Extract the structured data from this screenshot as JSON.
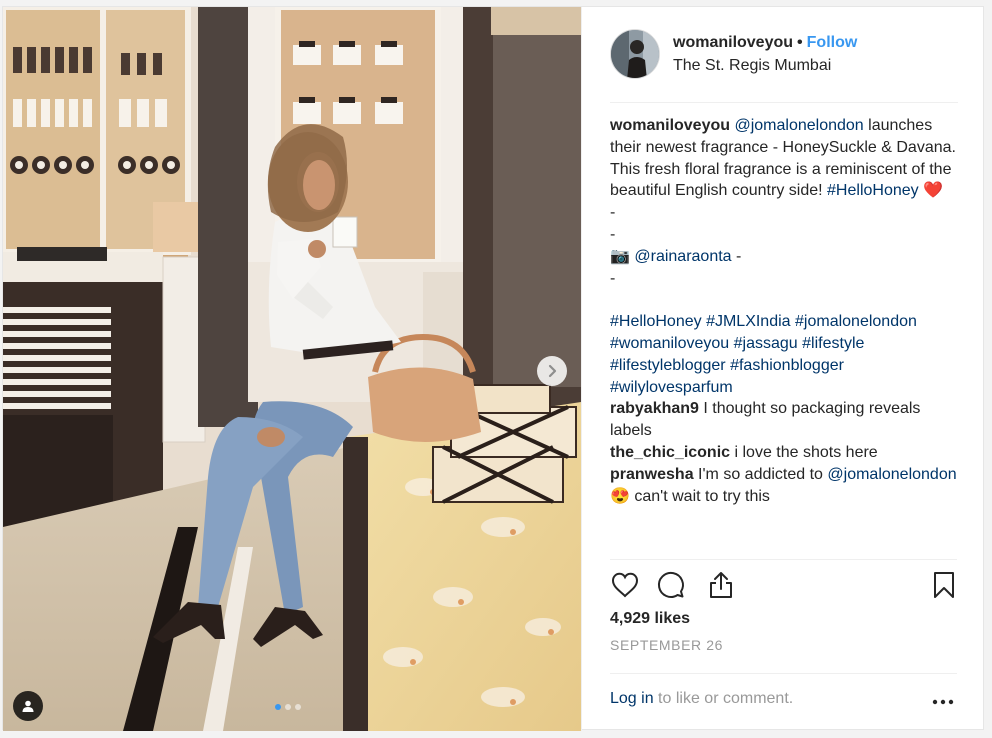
{
  "post": {
    "username": "womaniloveyou",
    "separator": "•",
    "follow_label": "Follow",
    "location": "The St. Regis Mumbai",
    "caption": {
      "username": "womaniloveyou",
      "mention": "@jomalonelondon",
      "text": "launches their newest fragrance - HoneySuckle & Davana. This fresh floral fragrance is a reminiscent of the beautiful English country side!",
      "hashtag": "#HelloHoney",
      "emoji": "❤️",
      "dash1": "-",
      "dash2": "-",
      "camera_emoji": "📷",
      "credit_mention": "@rainaraonta",
      "credit_suffix": "-",
      "dash3": "-",
      "tags": [
        "#HelloHoney",
        "#JMLXIndia",
        "#jomalonelondon",
        "#womaniloveyou",
        "#jassagu",
        "#lifestyle",
        "#lifestyleblogger",
        "#fashionblogger",
        "#wilylovesparfum"
      ]
    },
    "comments": [
      {
        "username": "rabyakhan9",
        "text": "I thought so packaging reveals labels"
      },
      {
        "username": "the_chic_iconic",
        "text": "i love the shots here"
      },
      {
        "username": "pranwesha",
        "text_before": "I'm so addicted to",
        "mention": "@jomalonelondon",
        "emoji": "😍",
        "text_after": "can't wait to try this"
      }
    ],
    "likes": "4,929 likes",
    "date": "SEPTEMBER 26",
    "login_link": "Log in",
    "login_text": "to like or comment.",
    "carousel": {
      "slides": 3,
      "active": 0
    },
    "icons": {
      "like": "heart-icon",
      "comment": "comment-icon",
      "share": "share-icon",
      "save": "bookmark-icon",
      "more": "more-dots-icon",
      "next": "chevron-right-icon",
      "tag": "person-tag-icon"
    },
    "colors": {
      "link": "#003569",
      "follow": "#3897f0",
      "muted": "#999999"
    }
  }
}
